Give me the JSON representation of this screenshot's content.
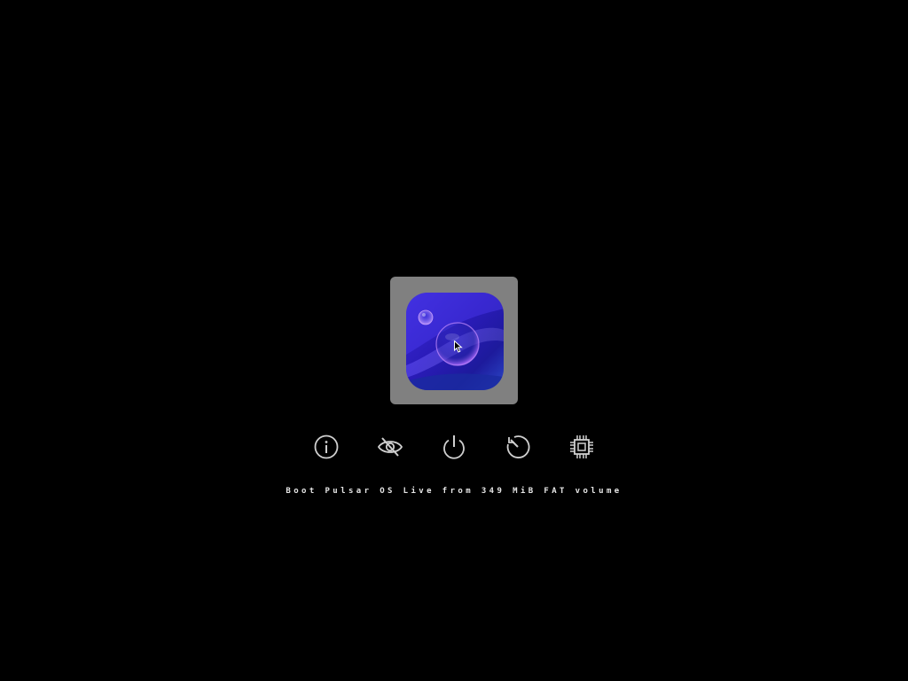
{
  "boot_menu": {
    "selected_entry": {
      "icon": "pulsar-os-icon",
      "selected": true
    },
    "tools": [
      {
        "icon": "info-icon"
      },
      {
        "icon": "hidden-eye-icon"
      },
      {
        "icon": "power-icon"
      },
      {
        "icon": "reboot-icon"
      },
      {
        "icon": "firmware-chip-icon"
      }
    ],
    "status_text": "Boot Pulsar OS Live from 349 MiB FAT volume"
  },
  "colors": {
    "background": "#000000",
    "selection_frame": "#808080",
    "tool_icon": "#cfcfcf",
    "status_text": "#e6e6e6"
  }
}
